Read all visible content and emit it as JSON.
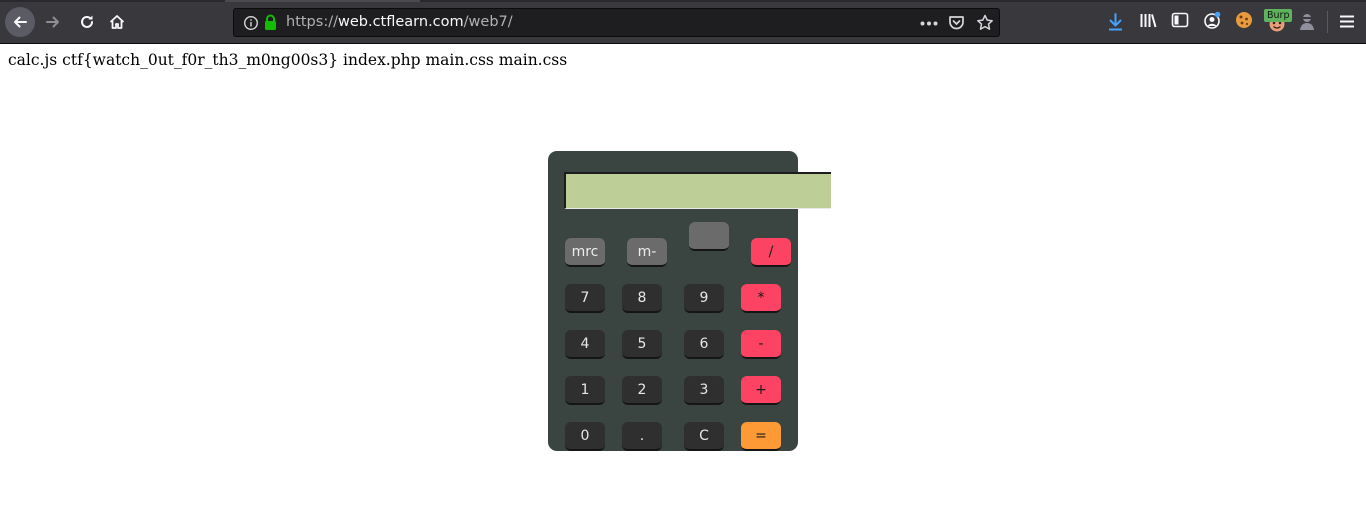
{
  "browser": {
    "url_scheme": "https://",
    "url_host": "web.ctflearn.com",
    "url_path": "/web7/",
    "burp_label": "Burp",
    "page_actions_icon": "more-horizontal-icon",
    "accent_download": "#45a1ff",
    "secure_lock_color": "#12bc00"
  },
  "page": {
    "file_list_text": "calc.js ctf{watch_0ut_f0r_th3_m0ng00s3} index.php main.css main.css"
  },
  "calculator": {
    "display_value": "",
    "keys": {
      "mrc": "mrc",
      "m_minus": "m-",
      "m_plus": "",
      "divide": "/",
      "seven": "7",
      "eight": "8",
      "nine": "9",
      "multiply": "*",
      "four": "4",
      "five": "5",
      "six": "6",
      "subtract": "-",
      "one": "1",
      "two": "2",
      "three": "3",
      "add": "+",
      "zero": "0",
      "dot": ".",
      "clear": "C",
      "equals": "="
    },
    "colors": {
      "body": "#3a4440",
      "display": "#bdcf96",
      "operator": "#fd4363",
      "equals": "#fe9a36"
    }
  }
}
